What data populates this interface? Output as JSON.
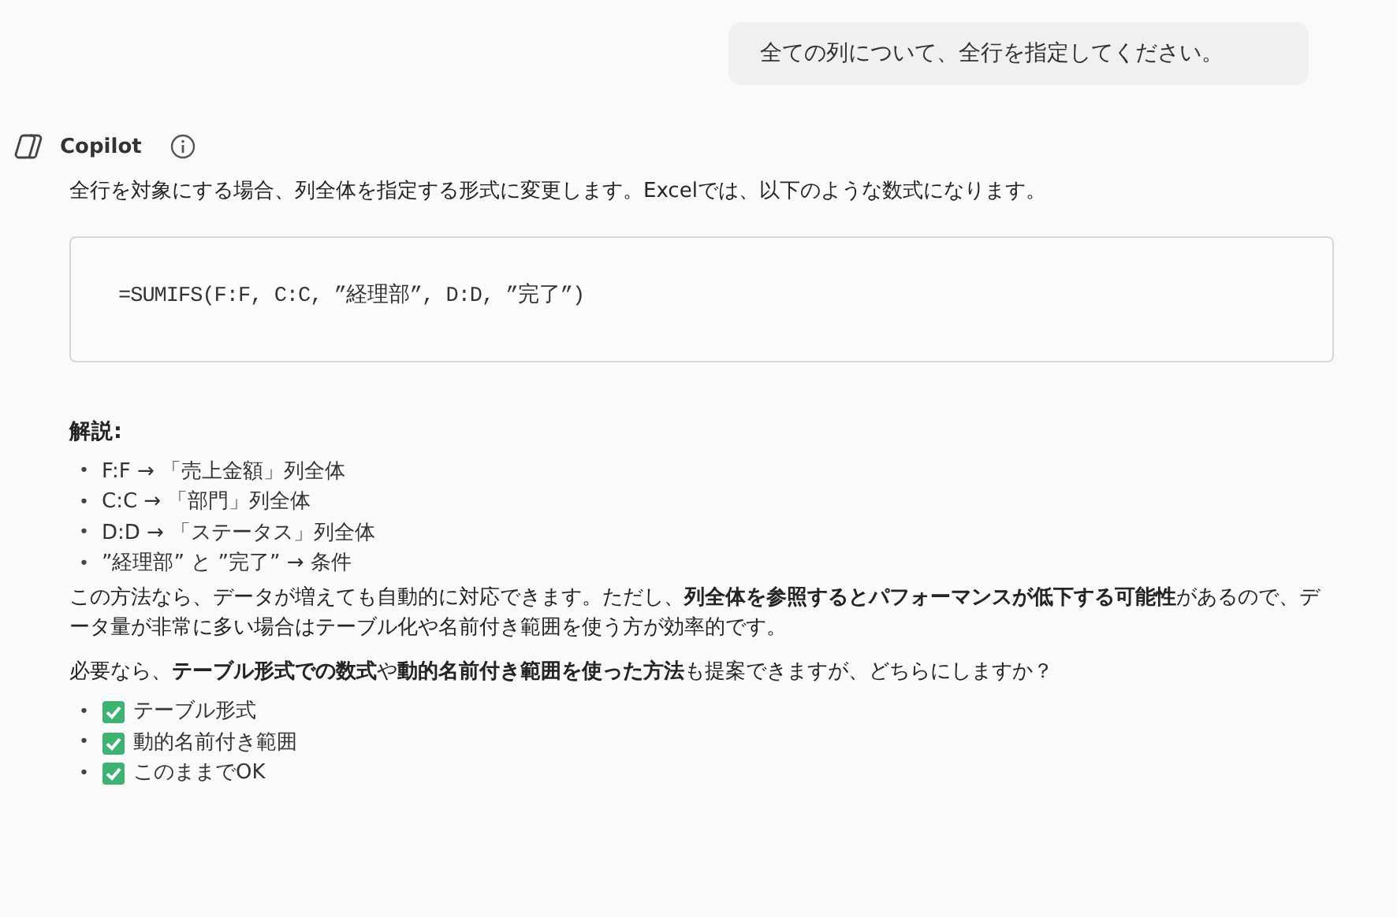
{
  "user_message": "全ての列について、全行を指定してください。",
  "assistant": {
    "name": "Copilot",
    "intro": "全行を対象にする場合、列全体を指定する形式に変更します。Excelでは、以下のような数式になります。",
    "code": "=SUMIFS(F:F, C:C, ”経理部”, D:D, ”完了”)",
    "explanation_heading": "解説:",
    "explanation_items": [
      {
        "marker": "•",
        "text": "F:F → 「売上金額」列全体"
      },
      {
        "marker": "•",
        "text": "C:C → 「部門」列全体"
      },
      {
        "marker": "•",
        "text": "D:D → 「ステータス」列全体"
      },
      {
        "marker": "•",
        "text": "”経理部” と ”完了” → 条件"
      }
    ],
    "paragraphs": [
      "この方法なら、データが増えても自動的に対応できます。ただし、**列全体を参照するとパフォーマンスが低下する可能性**があるので、データ量が非常に多い場合はテーブル化や名前付き範囲を使う方が効率的です。",
      "必要なら、**テーブル形式での数式**や**動的名前付き範囲を使った方法**も提案できますが、どちらにしますか？"
    ],
    "options": [
      {
        "marker": "•",
        "text": "テーブル形式"
      },
      {
        "marker": "•",
        "text": "動的名前付き範囲"
      },
      {
        "marker": "•",
        "text": "このままでOK"
      }
    ]
  }
}
